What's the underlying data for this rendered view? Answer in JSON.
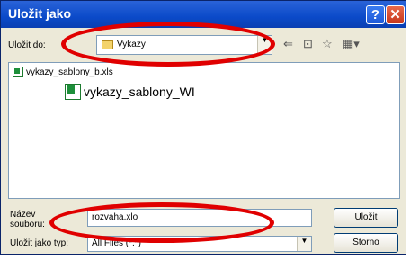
{
  "window": {
    "title": "Uložit jako"
  },
  "lookin": {
    "label": "Uložit do:",
    "value": "Vykazy"
  },
  "files": [
    {
      "name": "vykazy_sablony_b.xls"
    },
    {
      "name": "vykazy_sablony_WI"
    }
  ],
  "filename": {
    "label_line1": "Název",
    "label_line2": "souboru:",
    "value": "rozvaha.xlo"
  },
  "filetype": {
    "label": "Uložit jako typ:",
    "value": "All Files (*.*)"
  },
  "buttons": {
    "save": "Uložit",
    "cancel": "Storno"
  },
  "annotation_color": "#e00000"
}
